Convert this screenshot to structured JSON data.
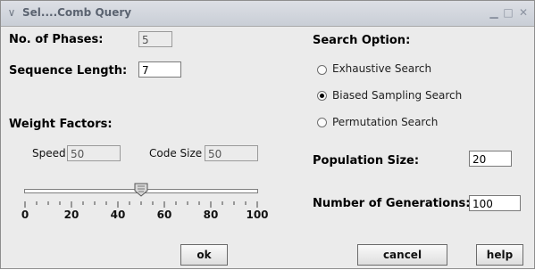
{
  "window": {
    "title": "Sel....Comb Query"
  },
  "phases": {
    "label": "No. of Phases:",
    "value": "5"
  },
  "sequence": {
    "label": "Sequence Length:",
    "value": "7"
  },
  "weights": {
    "label": "Weight Factors:",
    "speed_label": "Speed",
    "speed_value": "50",
    "code_label": "Code Size",
    "code_value": "50"
  },
  "slider": {
    "value": 50,
    "min": 0,
    "max": 100,
    "ticks": [
      "0",
      "20",
      "40",
      "60",
      "80",
      "100"
    ]
  },
  "search": {
    "label": "Search Option:",
    "options": [
      "Exhaustive Search",
      "Biased Sampling Search",
      "Permutation Search"
    ],
    "selected": "Biased Sampling Search"
  },
  "population": {
    "label": "Population Size:",
    "value": "20"
  },
  "generations": {
    "label": "Number of Generations:",
    "value": "100"
  },
  "buttons": {
    "ok": "ok",
    "cancel": "cancel",
    "help": "help"
  },
  "icons": {
    "menu": "chevron-down-icon",
    "minimize": "minimize-icon",
    "maximize": "maximize-icon",
    "close": "close-icon"
  }
}
